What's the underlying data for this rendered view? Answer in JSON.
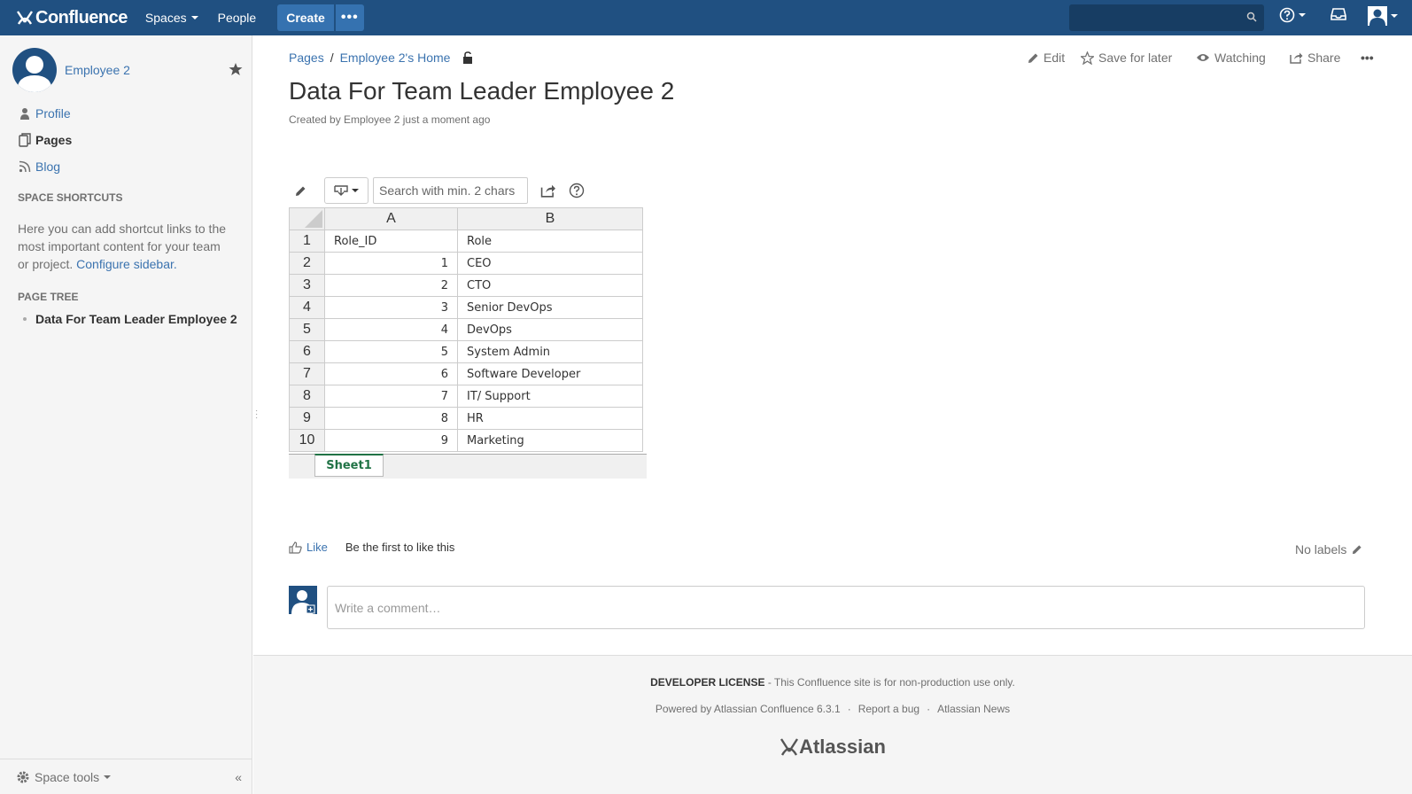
{
  "topnav": {
    "logo_text": "Confluence",
    "spaces_label": "Spaces",
    "people_label": "People",
    "create_label": "Create",
    "more_label": "•••"
  },
  "sidebar": {
    "space_name": "Employee 2",
    "links": [
      {
        "label": "Profile"
      },
      {
        "label": "Pages"
      },
      {
        "label": "Blog"
      }
    ],
    "shortcuts_heading": "SPACE SHORTCUTS",
    "shortcuts_text": "Here you can add shortcut links to the most important content for your team or project.",
    "configure_link": "Configure sidebar.",
    "page_tree_heading": "PAGE TREE",
    "tree_item": "Data For Team Leader Employee 2",
    "space_tools": "Space tools",
    "collapse": "«"
  },
  "breadcrumb": {
    "pages": "Pages",
    "sep": "/",
    "home": "Employee 2's Home"
  },
  "actions": {
    "edit": "Edit",
    "save": "Save for later",
    "watching": "Watching",
    "share": "Share",
    "more": "•••"
  },
  "page": {
    "title": "Data For Team Leader Employee 2",
    "byline": "Created by Employee 2 just a moment ago"
  },
  "spreadsheet": {
    "search_placeholder": "Search with min. 2 chars",
    "columns": [
      "A",
      "B"
    ],
    "rows": [
      {
        "n": "1",
        "a": "Role_ID",
        "b": "Role"
      },
      {
        "n": "2",
        "a": "1",
        "b": "CEO"
      },
      {
        "n": "3",
        "a": "2",
        "b": "CTO"
      },
      {
        "n": "4",
        "a": "3",
        "b": "Senior DevOps"
      },
      {
        "n": "5",
        "a": "4",
        "b": "DevOps"
      },
      {
        "n": "6",
        "a": "5",
        "b": "System Admin"
      },
      {
        "n": "7",
        "a": "6",
        "b": "Software Developer"
      },
      {
        "n": "8",
        "a": "7",
        "b": "IT/ Support"
      },
      {
        "n": "9",
        "a": "8",
        "b": "HR"
      },
      {
        "n": "10",
        "a": "9",
        "b": "Marketing"
      }
    ],
    "sheet_tab": "Sheet1"
  },
  "social": {
    "like": "Like",
    "first": "Be the first to like this",
    "labels": "No labels",
    "comment_placeholder": "Write a comment…"
  },
  "footer": {
    "license_bold": "DEVELOPER LICENSE",
    "license_text": " - This Confluence site is for non-production use only.",
    "powered": "Powered by Atlassian Confluence 6.3.1",
    "bug": "Report a bug",
    "news": "Atlassian News",
    "brand": "Atlassian"
  },
  "colors": {
    "header_bg": "#205081",
    "link": "#3b73af",
    "sheet_green": "#217346"
  }
}
